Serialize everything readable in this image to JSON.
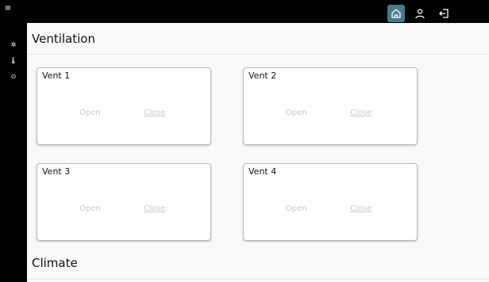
{
  "sections": {
    "ventilation_title": "Ventilation",
    "climate_title": "Climate"
  },
  "vents": [
    {
      "name": "Vent 1",
      "open_label": "Open",
      "close_label": "Close"
    },
    {
      "name": "Vent 2",
      "open_label": "Open",
      "close_label": "Close"
    },
    {
      "name": "Vent 3",
      "open_label": "Open",
      "close_label": "Close"
    },
    {
      "name": "Vent 4",
      "open_label": "Open",
      "close_label": "Close"
    }
  ],
  "colors": {
    "bar_bg": "#000000",
    "active_tab": "#4a7a8c"
  },
  "icons": {
    "menu": "hamburger-icon",
    "home": "home-icon",
    "user": "user-icon",
    "logout": "logout-icon",
    "sidebar": [
      "fan-icon",
      "thermometer-icon",
      "clock-icon"
    ]
  }
}
